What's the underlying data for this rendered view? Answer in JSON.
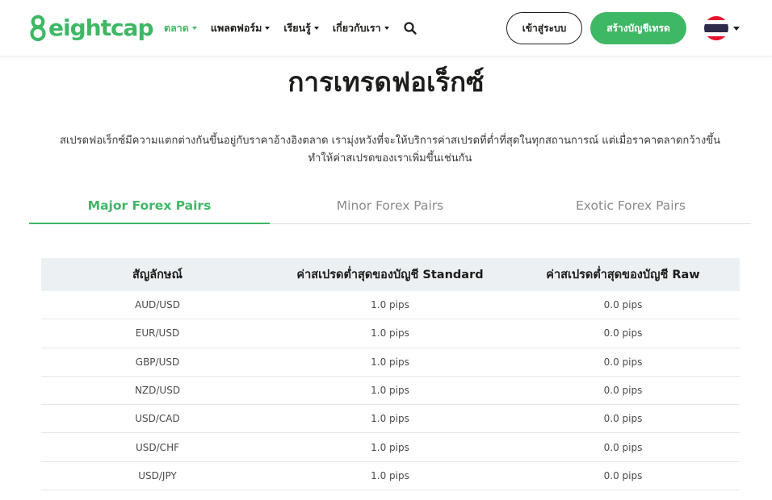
{
  "header": {
    "logo_text": "eightcap",
    "nav": [
      {
        "label": "ตลาด",
        "active": true
      },
      {
        "label": "แพลตฟอร์ม",
        "active": false
      },
      {
        "label": "เรียนรู้",
        "active": false
      },
      {
        "label": "เกี่ยวกับเรา",
        "active": false
      }
    ],
    "login_label": "เข้าสู่ระบบ",
    "signup_label": "สร้างบัญชีเทรด"
  },
  "colors": {
    "brand": "#3fb866",
    "text": "#1d1d1b",
    "table_header_bg": "#edf0f3"
  },
  "page": {
    "title": "การเทรดฟอเร็กซ์",
    "intro_line1": "สเปรดฟอเร็กซ์มีความแตกต่างกันขึ้นอยู่กับราคาอ้างอิงตลาด เรามุ่งหวังที่จะให้บริการค่าสเปรดที่ต่ำที่สุดในทุกสถานการณ์ แต่เมื่อราคาตลาดกว้างขึ้น",
    "intro_line2": "ทำให้ค่าสเปรดของเราเพิ่มขึ้นเช่นกัน"
  },
  "tabs": [
    {
      "label": "Major Forex Pairs",
      "active": true
    },
    {
      "label": "Minor Forex Pairs",
      "active": false
    },
    {
      "label": "Exotic Forex Pairs",
      "active": false
    }
  ],
  "table": {
    "headers": [
      "สัญลักษณ์",
      "ค่าสเปรดต่ำสุดของบัญชี Standard",
      "ค่าสเปรดต่ำสุดของบัญชี Raw"
    ],
    "rows": [
      [
        "AUD/USD",
        "1.0 pips",
        "0.0 pips"
      ],
      [
        "EUR/USD",
        "1.0 pips",
        "0.0 pips"
      ],
      [
        "GBP/USD",
        "1.0 pips",
        "0.0 pips"
      ],
      [
        "NZD/USD",
        "1.0 pips",
        "0.0 pips"
      ],
      [
        "USD/CAD",
        "1.0 pips",
        "0.0 pips"
      ],
      [
        "USD/CHF",
        "1.0 pips",
        "0.0 pips"
      ],
      [
        "USD/JPY",
        "1.0 pips",
        "0.0 pips"
      ]
    ]
  },
  "icons": {
    "search": "search-icon",
    "flag": "thailand-flag-icon",
    "logo": "eightcap-logo-mark"
  }
}
